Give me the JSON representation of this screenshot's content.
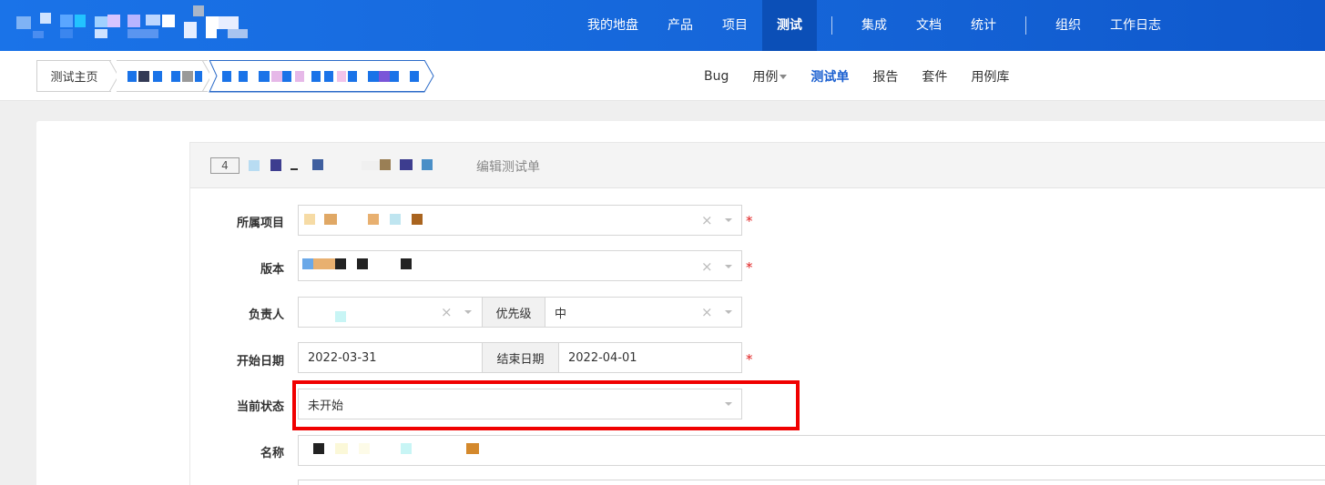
{
  "topnav": {
    "items": [
      {
        "label": "我的地盘",
        "active": false
      },
      {
        "label": "产品",
        "active": false
      },
      {
        "label": "项目",
        "active": false
      },
      {
        "label": "测试",
        "active": true
      },
      {
        "label": "集成",
        "active": false
      },
      {
        "label": "文档",
        "active": false
      },
      {
        "label": "统计",
        "active": false
      },
      {
        "label": "组织",
        "active": false
      },
      {
        "label": "工作日志",
        "active": false
      }
    ]
  },
  "breadcrumb": {
    "home": "测试主页"
  },
  "subnav": {
    "items": [
      {
        "label": "Bug",
        "active": false
      },
      {
        "label": "用例",
        "active": false,
        "dropdown": true
      },
      {
        "label": "测试单",
        "active": true
      },
      {
        "label": "报告",
        "active": false
      },
      {
        "label": "套件",
        "active": false
      },
      {
        "label": "用例库",
        "active": false
      }
    ]
  },
  "form": {
    "id": "4",
    "heading": "编辑测试单",
    "project_label": "所属项目",
    "build_label": "版本",
    "owner_label": "负责人",
    "priority_label": "优先级",
    "priority_value": "中",
    "begin_label": "开始日期",
    "begin_value": "2022-03-31",
    "end_label": "结束日期",
    "end_value": "2022-04-01",
    "status_label": "当前状态",
    "status_value": "未开始",
    "name_label": "名称",
    "required_mark": "*",
    "clear_mark": "×"
  },
  "colors": {
    "topbar": "#1a73e8",
    "active_nav": "#0b4fb7",
    "subnav_active": "#1a5fd0",
    "required": "#e02020",
    "highlight": "#f00000"
  }
}
